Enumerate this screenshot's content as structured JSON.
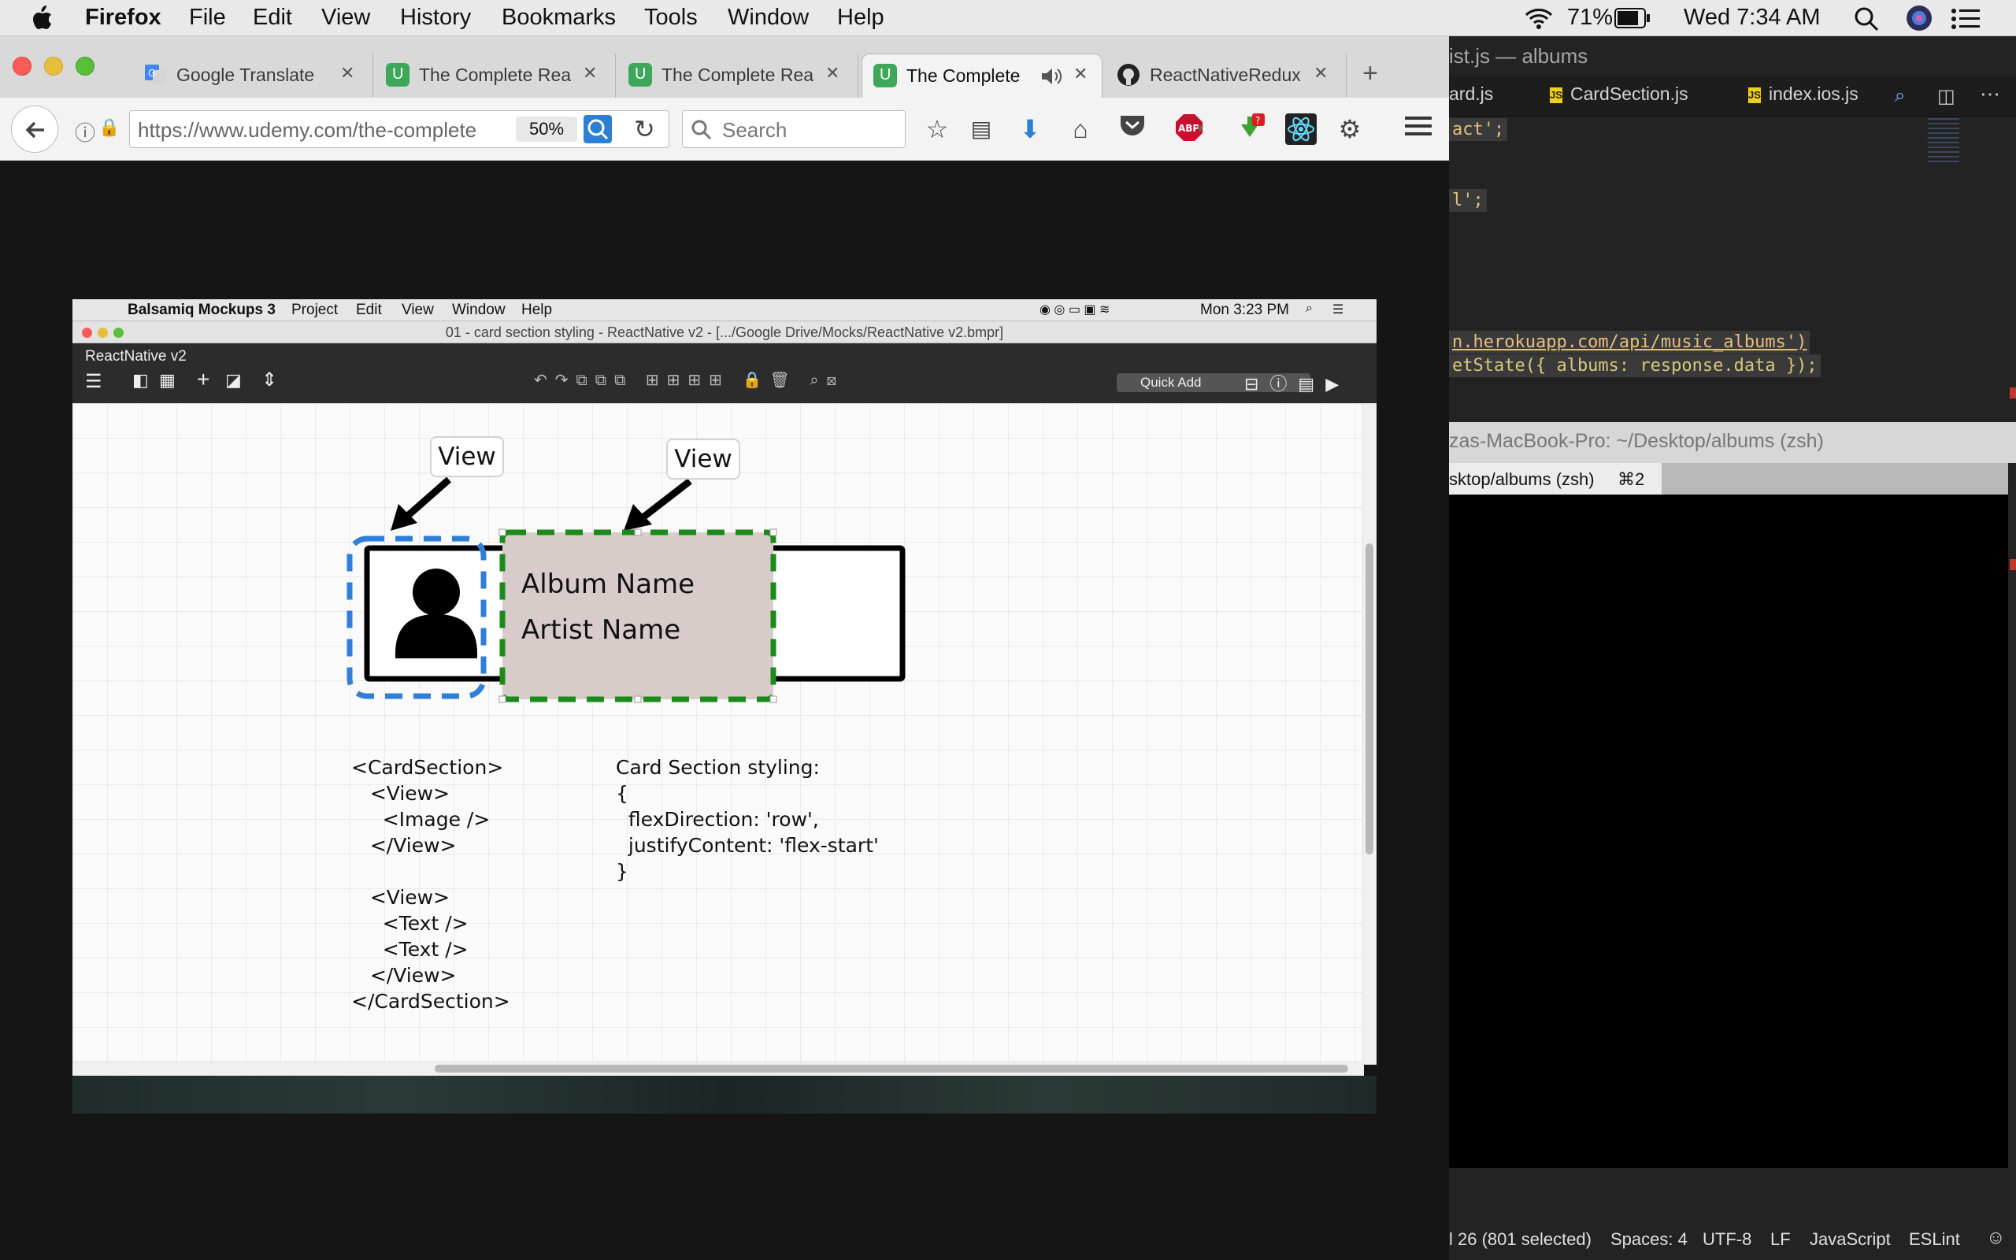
{
  "menubar": {
    "app": "Firefox",
    "items": [
      "File",
      "Edit",
      "View",
      "History",
      "Bookmarks",
      "Tools",
      "Window",
      "Help"
    ],
    "battery": "71%",
    "clock": "Wed 7:34 AM"
  },
  "firefox": {
    "tabs": [
      {
        "label": "Google Translate",
        "icon": "google-translate-icon"
      },
      {
        "label": "The Complete Rea",
        "icon": "udemy-icon"
      },
      {
        "label": "The Complete Rea",
        "icon": "udemy-icon"
      },
      {
        "label": "The Complete",
        "icon": "udemy-icon",
        "active": true,
        "audio": true
      },
      {
        "label": "ReactNativeRedux",
        "icon": "github-icon"
      }
    ],
    "url": "https://www.udemy.com/the-complete",
    "zoom": "50%",
    "search_placeholder": "Search",
    "abp_badge": "ABP",
    "download_badge": "?"
  },
  "atom": {
    "title": "ist.js — albums",
    "tabs": [
      "ard.js",
      "CardSection.js",
      "index.ios.js"
    ],
    "code_lines": [
      "act';",
      "l';",
      "n.herokuapp.com/api/music_albums')",
      "etState({ albums: response.data });"
    ],
    "terminal_title": "zas-MacBook-Pro: ~/Desktop/albums (zsh)",
    "terminal_tab": "sktop/albums (zsh)",
    "terminal_tab_shortcut": "⌘2",
    "status": {
      "selection": "l 26 (801 selected)",
      "spaces": "Spaces: 4",
      "encoding": "UTF-8",
      "line_ending": "LF",
      "grammar": "JavaScript",
      "linter": "ESLint"
    }
  },
  "balsamiq": {
    "menubar": {
      "app": "Balsamiq Mockups 3",
      "items": [
        "Project",
        "Edit",
        "View",
        "Window",
        "Help"
      ],
      "clock": "Mon 3:23 PM"
    },
    "window_title": "01 - card section styling - ReactNative v2 - [.../Google Drive/Mocks/ReactNative v2.bmpr]",
    "project": "ReactNative v2",
    "quick_add": "Quick Add",
    "mock": {
      "view_label_1": "View",
      "view_label_2": "View",
      "album_name": "Album Name",
      "artist_name": "Artist Name",
      "code_tree": "<CardSection>\n   <View>\n     <Image />\n   </View>\n\n   <View>\n     <Text />\n     <Text />\n   </View>\n</CardSection>",
      "styling_text": "Card Section styling:\n{\n  flexDirection: 'row',\n  justifyContent: 'flex-start'\n}"
    }
  }
}
